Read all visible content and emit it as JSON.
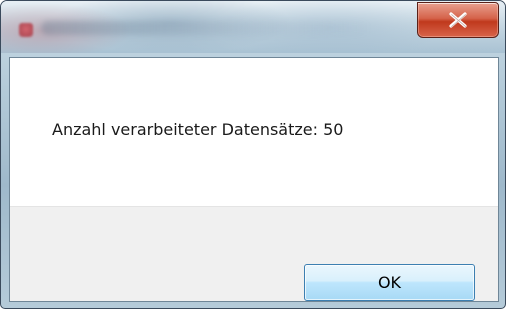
{
  "dialog": {
    "message": "Anzahl verarbeiteter Datensätze: 50",
    "ok_label": "OK",
    "close_icon": "close-x-icon",
    "accent": "#c0391d",
    "button_border": "#3c7fb1"
  }
}
